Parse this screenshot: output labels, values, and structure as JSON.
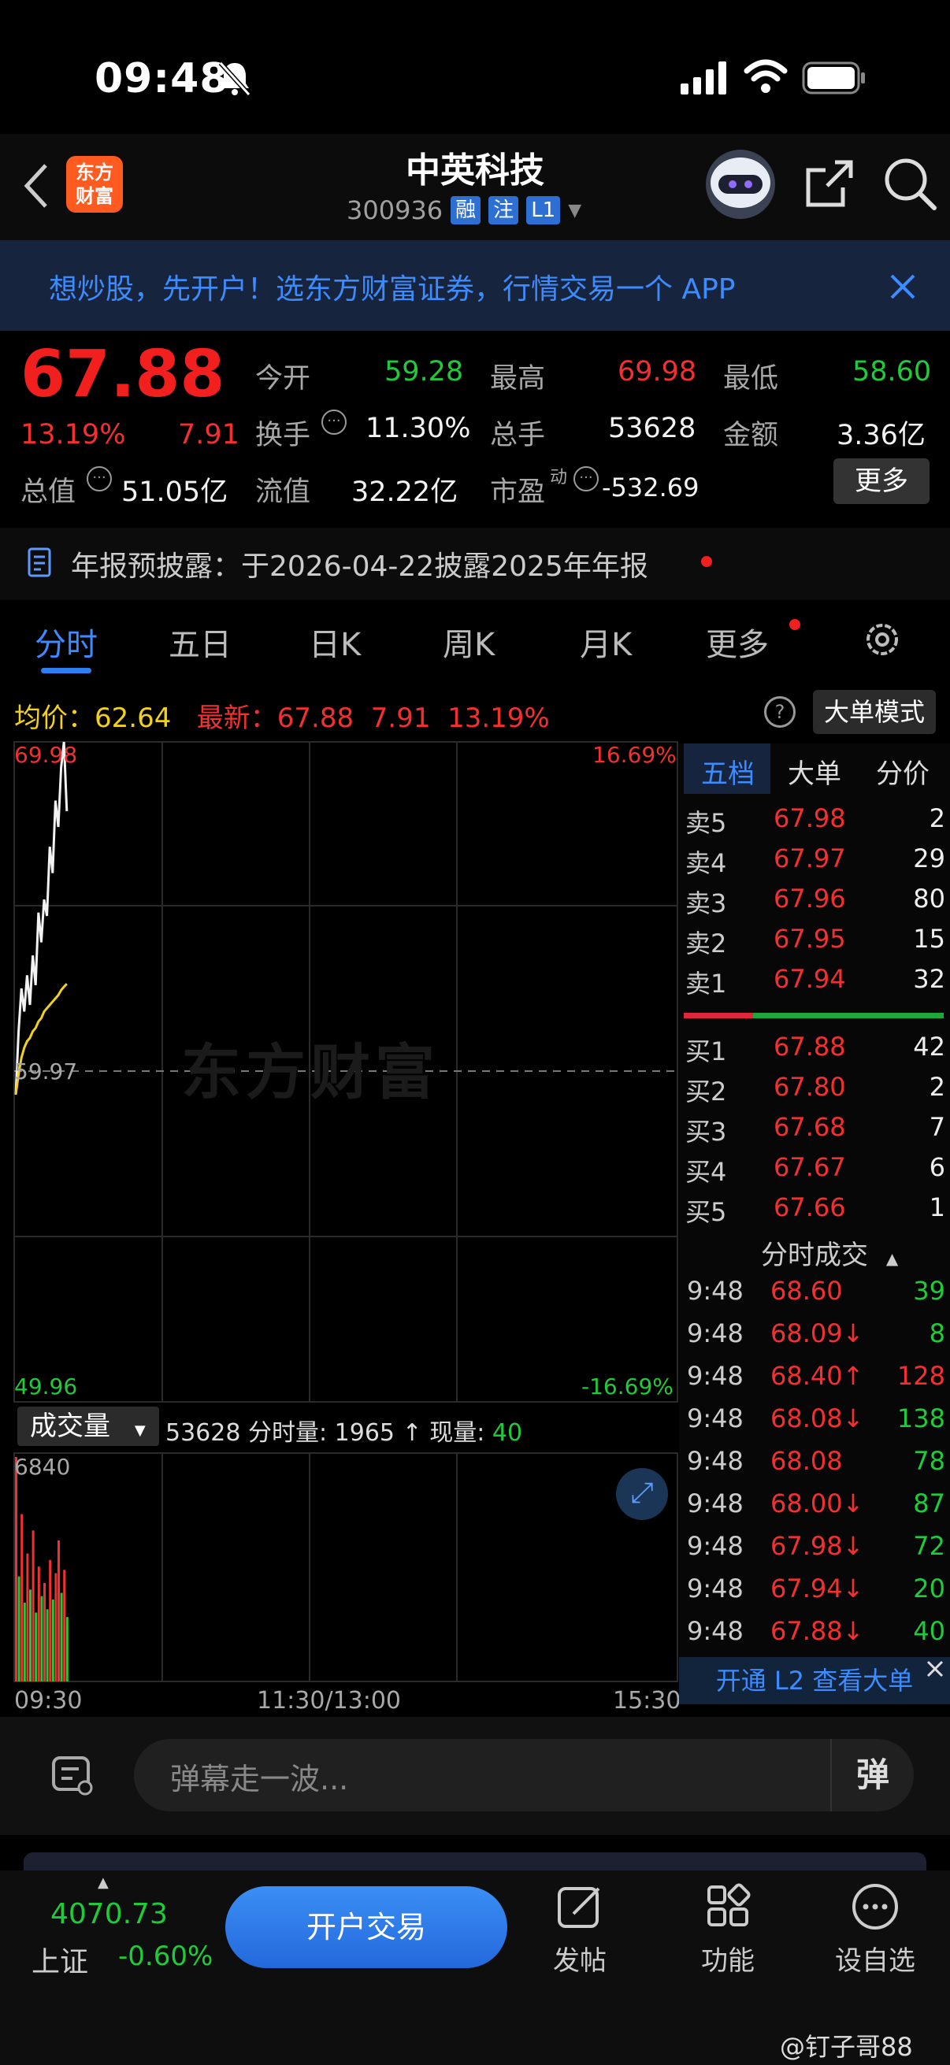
{
  "status": {
    "time": "09:48"
  },
  "header": {
    "title": "中英科技",
    "code": "300936",
    "tags": [
      "融",
      "注",
      "L1"
    ],
    "logo": [
      "东方",
      "财富"
    ]
  },
  "banner": {
    "text": "想炒股，先开户！选东方财富证券，行情交易一个 APP"
  },
  "quote": {
    "price": "67.88",
    "change_pct": "13.19%",
    "change": "7.91",
    "open_label": "今开",
    "open": "59.28",
    "high_label": "最高",
    "high": "69.98",
    "low_label": "最低",
    "low": "58.60",
    "turnover_label": "换手",
    "turnover": "11.30%",
    "volume_label": "总手",
    "volume": "53628",
    "amount_label": "金额",
    "amount": "3.36亿",
    "mktcap_label": "总值",
    "mktcap": "51.05亿",
    "float_label": "流值",
    "float": "32.22亿",
    "pe_label": "市盈",
    "pe_sup": "动",
    "pe": "-532.69",
    "more": "更多"
  },
  "notice": {
    "text": "年报预披露：于2026-04-22披露2025年年报"
  },
  "tabs": [
    "分时",
    "五日",
    "日K",
    "周K",
    "月K",
    "更多"
  ],
  "intraday": {
    "avg_label": "均价：",
    "avg": "62.64",
    "last_label": "最新：",
    "last": "67.88",
    "last_change": "7.91",
    "last_pct": "13.19%",
    "big_order_mode": "大单模式",
    "y_top": "69.98",
    "y_mid": "59.97",
    "y_bottom": "49.96",
    "pct_top": "16.69%",
    "pct_bottom": "-16.69%",
    "watermark": "东方财富",
    "vol_selector": "成交量",
    "vol_total": "53628",
    "vol_period_label": "分时量:",
    "vol_period": "1965",
    "vol_now_label": "现量:",
    "vol_now": "40",
    "vol_max": "6840",
    "time_start": "09:30",
    "time_mid": "11:30/13:00",
    "time_end": "15:30"
  },
  "chart_data": {
    "type": "line",
    "title": "",
    "xlabel": "",
    "ylabel": "",
    "ylim": [
      49.96,
      69.98
    ],
    "x": [
      "09:30",
      "09:31",
      "09:32",
      "09:33",
      "09:34",
      "09:35",
      "09:36",
      "09:37",
      "09:38",
      "09:39",
      "09:40",
      "09:41",
      "09:42",
      "09:43",
      "09:44",
      "09:45",
      "09:46",
      "09:47",
      "09:48"
    ],
    "series": [
      {
        "values": [
          59.28,
          61.2,
          62.5,
          61.8,
          62.9,
          62.0,
          63.5,
          62.6,
          64.8,
          63.9,
          65.2,
          64.7,
          66.8,
          66.0,
          68.2,
          67.4,
          69.2,
          69.98,
          67.88
        ]
      },
      {
        "values": [
          59.28,
          59.9,
          60.4,
          60.7,
          60.9,
          61.0,
          61.2,
          61.3,
          61.5,
          61.6,
          61.8,
          61.9,
          62.0,
          62.1,
          62.2,
          62.3,
          62.45,
          62.55,
          62.64
        ]
      }
    ],
    "volume": {
      "ylim": [
        0,
        6840
      ],
      "values": [
        6840,
        3200,
        5100,
        2400,
        3900,
        2800,
        4600,
        2100,
        3500,
        2600,
        3000,
        2200,
        3700,
        2500,
        3300,
        4300,
        2700,
        3400,
        1965
      ],
      "up": [
        true,
        false,
        true,
        false,
        true,
        false,
        true,
        false,
        true,
        false,
        true,
        false,
        true,
        false,
        true,
        true,
        false,
        true,
        false
      ]
    }
  },
  "orderbook": {
    "tabs": [
      "五档",
      "大单",
      "分价"
    ],
    "asks": [
      {
        "label": "卖5",
        "price": "67.98",
        "vol": "2"
      },
      {
        "label": "卖4",
        "price": "67.97",
        "vol": "29"
      },
      {
        "label": "卖3",
        "price": "67.96",
        "vol": "80"
      },
      {
        "label": "卖2",
        "price": "67.95",
        "vol": "15"
      },
      {
        "label": "卖1",
        "price": "67.94",
        "vol": "32"
      }
    ],
    "bids": [
      {
        "label": "买1",
        "price": "67.88",
        "vol": "42"
      },
      {
        "label": "买2",
        "price": "67.80",
        "vol": "2"
      },
      {
        "label": "买3",
        "price": "67.68",
        "vol": "7"
      },
      {
        "label": "买4",
        "price": "67.67",
        "vol": "6"
      },
      {
        "label": "买5",
        "price": "67.66",
        "vol": "1"
      }
    ],
    "trades_title": "分时成交",
    "trades": [
      {
        "time": "9:48",
        "price": "68.60",
        "arrow": "",
        "vol": "39",
        "vcolor": "green"
      },
      {
        "time": "9:48",
        "price": "68.09↓",
        "arrow": "",
        "vol": "8",
        "vcolor": "green"
      },
      {
        "time": "9:48",
        "price": "68.40↑",
        "arrow": "",
        "vol": "128",
        "vcolor": "red"
      },
      {
        "time": "9:48",
        "price": "68.08↓",
        "arrow": "",
        "vol": "138",
        "vcolor": "green"
      },
      {
        "time": "9:48",
        "price": "68.08",
        "arrow": "",
        "vol": "78",
        "vcolor": "green"
      },
      {
        "time": "9:48",
        "price": "68.00↓",
        "arrow": "",
        "vol": "87",
        "vcolor": "green"
      },
      {
        "time": "9:48",
        "price": "67.98↓",
        "arrow": "",
        "vol": "72",
        "vcolor": "green"
      },
      {
        "time": "9:48",
        "price": "67.94↓",
        "arrow": "",
        "vol": "20",
        "vcolor": "green"
      },
      {
        "time": "9:48",
        "price": "67.88↓",
        "arrow": "",
        "vol": "40",
        "vcolor": "green"
      }
    ],
    "l2": "开通 L2 查看大单"
  },
  "comment": {
    "placeholder": "弹幕走一波...",
    "danmu": "弹"
  },
  "bottom": {
    "index_value": "4070.73",
    "index_name": "上证",
    "index_change": "-0.60%",
    "trade": "开户交易",
    "post": "发帖",
    "func": "功能",
    "watch": "设自选",
    "watermark": "@钉子哥88"
  }
}
